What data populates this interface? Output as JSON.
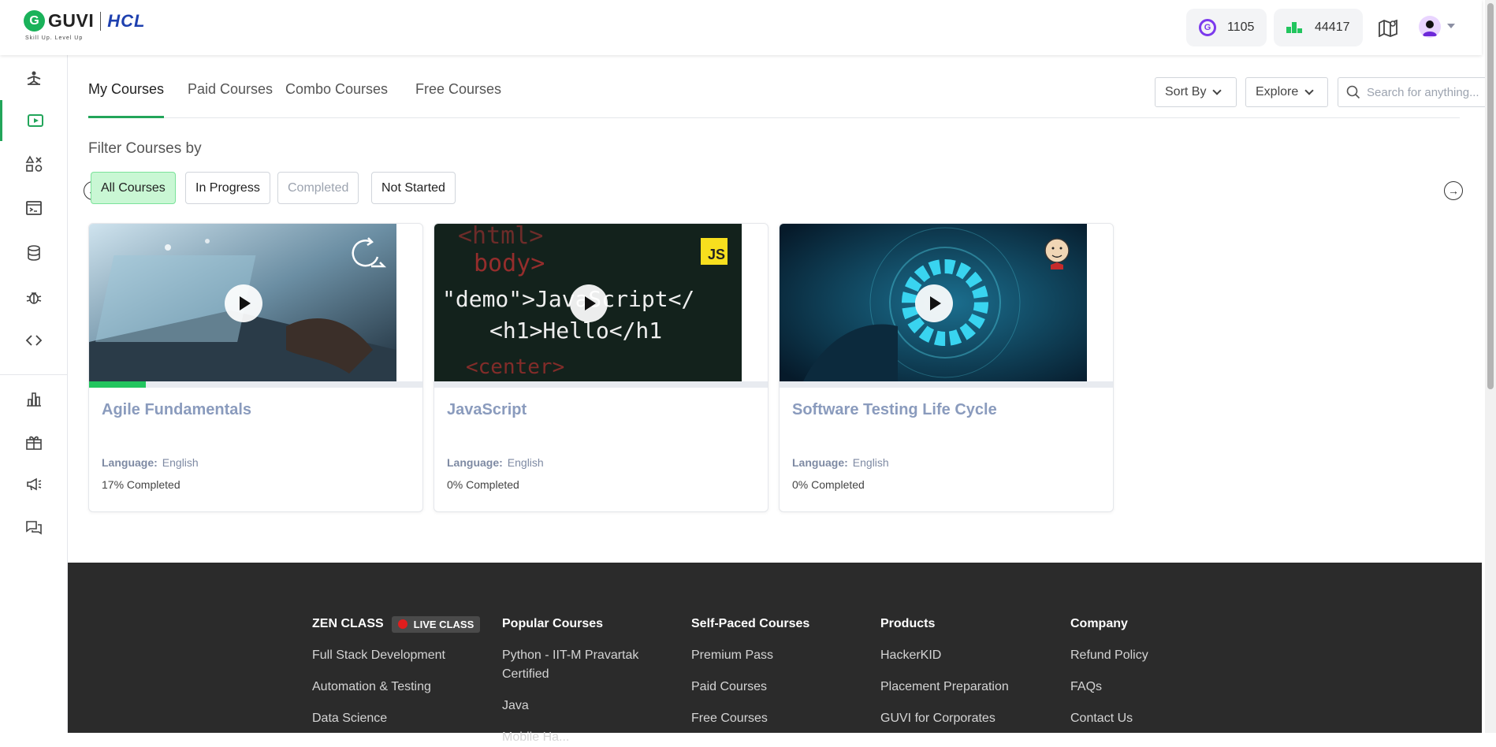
{
  "brand": {
    "logo_mark": "G",
    "name": "GUVI",
    "partner": "HCL",
    "tagline": "Skill Up. Level Up"
  },
  "header": {
    "gems": {
      "icon": "gem-coin-icon",
      "value": "1105"
    },
    "rank": {
      "icon": "leaderboard-icon",
      "value": "44417"
    },
    "map_icon": "roadmap-icon",
    "avatar_icon": "user-avatar-icon"
  },
  "sidebar": {
    "items": [
      {
        "name": "yoga-icon",
        "active": false
      },
      {
        "name": "courses-play-icon",
        "active": true
      },
      {
        "name": "shapes-icon",
        "active": false
      },
      {
        "name": "terminal-icon",
        "active": false
      },
      {
        "name": "database-icon",
        "active": false
      },
      {
        "name": "bug-icon",
        "active": false
      },
      {
        "name": "code-icon",
        "active": false
      },
      {
        "name": "chart-icon",
        "active": false
      },
      {
        "name": "gift-icon",
        "active": false
      },
      {
        "name": "megaphone-icon",
        "active": false
      },
      {
        "name": "chat-icon",
        "active": false
      }
    ]
  },
  "tabs": [
    {
      "label": "My Courses",
      "active": true
    },
    {
      "label": "Paid Courses",
      "active": false
    },
    {
      "label": "Combo Courses",
      "active": false
    },
    {
      "label": "Free Courses",
      "active": false
    }
  ],
  "toolbar": {
    "sort_label": "Sort By",
    "explore_label": "Explore",
    "search_placeholder": "Search for anything..."
  },
  "filter": {
    "title": "Filter Courses by",
    "chips": [
      {
        "label": "All Courses",
        "state": "active"
      },
      {
        "label": "In Progress",
        "state": "normal"
      },
      {
        "label": "Completed",
        "state": "disabled"
      },
      {
        "label": "Not Started",
        "state": "normal"
      }
    ]
  },
  "courses": [
    {
      "title": "Agile Fundamentals",
      "language_label": "Language:",
      "language": "English",
      "progress_text": "17% Completed",
      "progress": 0.17,
      "badge_icon": "refresh-cycle-icon"
    },
    {
      "title": "JavaScript",
      "language_label": "Language:",
      "language": "English",
      "progress_text": "0% Completed",
      "progress": 0,
      "badge": "JS",
      "thumb_lines": [
        "<html>",
        "body>",
        "\"demo\">JavaScript</",
        "<h1>Hello</h1",
        "<center>"
      ]
    },
    {
      "title": "Software Testing Life Cycle",
      "language_label": "Language:",
      "language": "English",
      "progress_text": "0% Completed",
      "progress": 0,
      "badge_icon": "jenkins-butler-icon"
    }
  ],
  "footer": {
    "columns": [
      {
        "heading": "ZEN CLASS",
        "badge": "LIVE CLASS",
        "links": [
          "Full Stack Development",
          "Automation & Testing",
          "Data Science"
        ]
      },
      {
        "heading": "Popular Courses",
        "links": [
          "Python - IIT-M Pravartak Certified",
          "Java",
          "Mobile Ha..."
        ]
      },
      {
        "heading": "Self-Paced Courses",
        "links": [
          "Premium Pass",
          "Paid Courses",
          "Free Courses"
        ]
      },
      {
        "heading": "Products",
        "links": [
          "HackerKID",
          "Placement Preparation",
          "GUVI for Corporates"
        ]
      },
      {
        "heading": "Company",
        "links": [
          "Refund Policy",
          "FAQs",
          "Contact Us"
        ]
      }
    ]
  },
  "colors": {
    "accent": "#22a55a",
    "chip_active_bg": "#c9f7d4",
    "footer_bg": "#2b2b2b",
    "card_title": "#8a9bbd"
  }
}
